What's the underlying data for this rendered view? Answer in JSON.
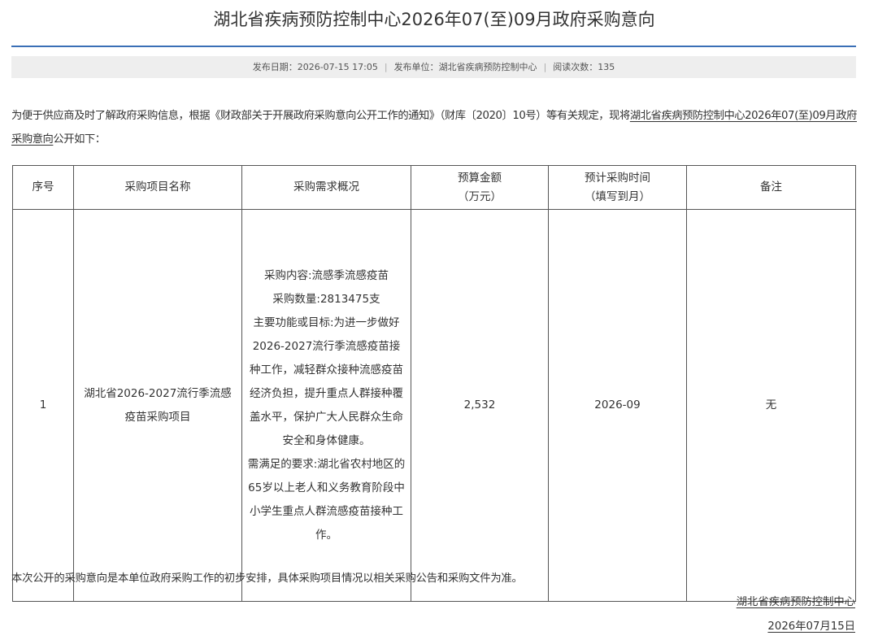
{
  "title": "湖北省疾病预防控制中心2026年07(至)09月政府采购意向",
  "meta": {
    "publish_date_label": "发布日期：",
    "publish_date": "2026-07-15 17:05",
    "publisher_label": "发布单位：",
    "publisher": "湖北省疾病预防控制中心",
    "views_label": "阅读次数：",
    "views": "135",
    "separator": "|"
  },
  "intro": {
    "text_before": "为便于供应商及时了解政府采购信息，根据《财政部关于开展政府采购意向公开工作的通知》（财库〔2020〕10号）等有关规定，现将",
    "underlined": "湖北省疾病预防控制中心2026年07(至)09月政府采购意向",
    "text_after": "公开如下："
  },
  "table": {
    "headers": {
      "seq": "序号",
      "name": "采购项目名称",
      "requirements": "采购需求概况",
      "budget_line1": "预算金额",
      "budget_line2": "（万元）",
      "time_line1": "预计采购时间",
      "time_line2": "（填写到月）",
      "remark": "备注"
    },
    "rows": [
      {
        "seq": "1",
        "name": "湖北省2026-2027流行季流感疫苗采购项目",
        "requirements": [
          "采购内容:流感季流感疫苗",
          "采购数量:2813475支",
          "主要功能或目标:为进一步做好2026-2027流行季流感疫苗接种工作，减轻群众接种流感疫苗经济负担，提升重点人群接种覆盖水平，保护广大人民群众生命安全和身体健康。",
          "需满足的要求:湖北省农村地区的65岁以上老人和义务教育阶段中小学生重点人群流感疫苗接种工作。"
        ],
        "budget": "2,532",
        "time": "2026-09",
        "remark": "无"
      }
    ]
  },
  "footer": {
    "note": "本次公开的采购意向是本单位政府采购工作的初步安排，具体采购项目情况以相关采购公告和采购文件为准。",
    "org": "湖北省疾病预防控制中心",
    "date": "2026年07月15日"
  }
}
